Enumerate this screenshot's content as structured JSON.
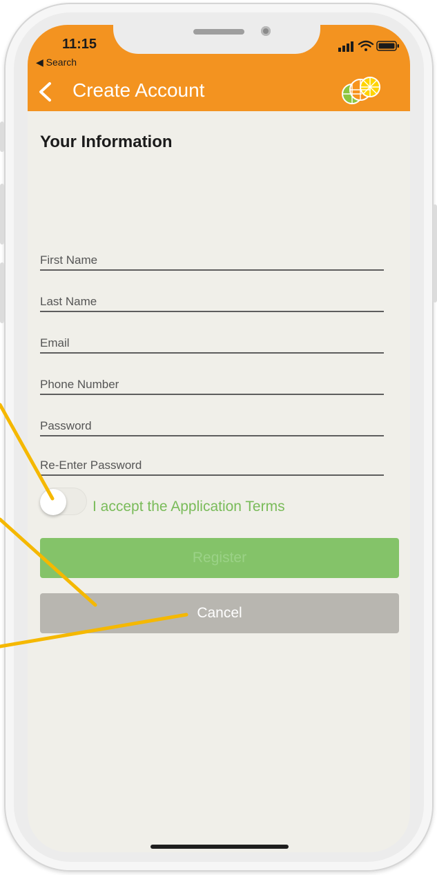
{
  "status_bar": {
    "time": "11:15",
    "back_app_label": "◀ Search"
  },
  "header": {
    "title": "Create Account",
    "back_icon": "chevron-left-icon",
    "logo_icon": "citrus-slices-logo",
    "bg_color": "#f39320"
  },
  "form": {
    "section_title": "Your Information",
    "fields": [
      {
        "label": "First Name"
      },
      {
        "label": "Last Name"
      },
      {
        "label": "Email"
      },
      {
        "label": "Phone Number"
      },
      {
        "label": "Password"
      },
      {
        "label": "Re-Enter Password"
      }
    ],
    "terms_label": "I accept the Application Terms",
    "terms_accepted": false
  },
  "buttons": {
    "register": "Register",
    "cancel": "Cancel"
  },
  "colors": {
    "accent": "#f39320",
    "register_bg": "#84c369",
    "cancel_bg": "#b8b6b0",
    "terms_text": "#79bb59",
    "annotation": "#f5b800"
  }
}
